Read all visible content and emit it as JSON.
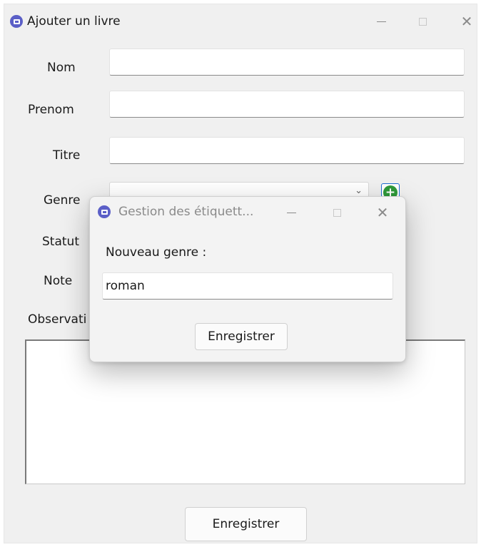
{
  "main_window": {
    "title": "Ajouter un livre",
    "labels": {
      "nom": "Nom",
      "prenom": "Prenom",
      "titre": "Titre",
      "genre": "Genre",
      "statut": "Statut",
      "note": "Note",
      "observation": "Observati"
    },
    "fields": {
      "nom_value": "",
      "prenom_value": "",
      "titre_value": "",
      "genre_selected": ""
    },
    "combo_arrow_glyph": "⌄",
    "add_icon_glyph": "+",
    "save_label": "Enregistrer",
    "window_controls": {
      "minimize": "–",
      "maximize": "☐",
      "close": "✕"
    }
  },
  "dialog": {
    "title": "Gestion des étiquett...",
    "prompt_label": "Nouveau genre :",
    "input_value": "roman",
    "save_label": "Enregistrer",
    "window_controls": {
      "minimize": "–",
      "maximize": "☐",
      "close": "✕"
    }
  },
  "icons": {
    "app_icon": "app-icon",
    "add_genre": "add-circle-icon",
    "dropdown": "chevron-down-icon"
  },
  "colors": {
    "app_icon": "#5b5fc7",
    "add_button_green": "#2f9a3a",
    "focus_blue": "#1f6fd1",
    "window_bg": "#f0f0f0"
  }
}
